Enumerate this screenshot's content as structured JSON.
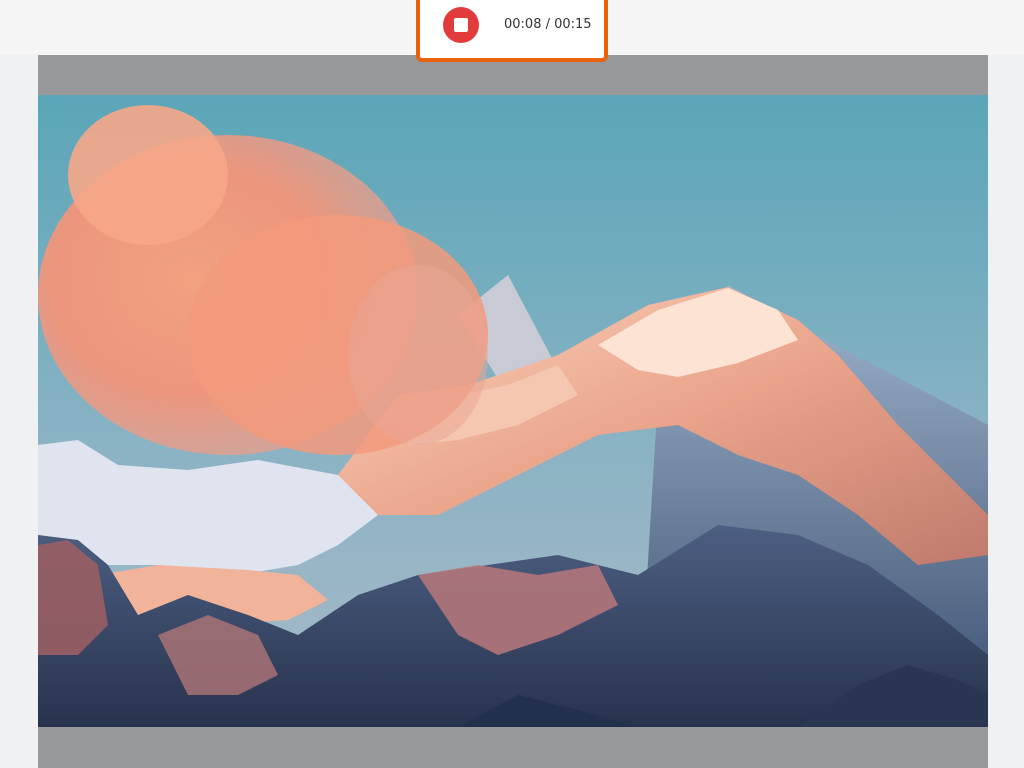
{
  "recorder": {
    "stop_icon": "stop-icon",
    "time_display": "00:08 / 00:15",
    "accent_color": "#e8620e",
    "stop_color": "#e23b3b"
  },
  "content": {
    "image_subject": "mountain-landscape"
  }
}
